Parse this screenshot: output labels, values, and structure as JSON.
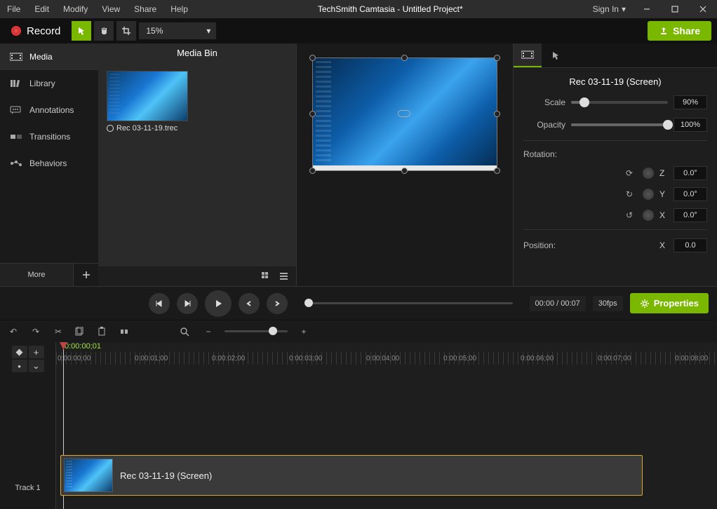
{
  "menu": [
    "File",
    "Edit",
    "Modify",
    "View",
    "Share",
    "Help"
  ],
  "title": "TechSmith Camtasia - Untitled Project*",
  "signin": "Sign In",
  "record_label": "Record",
  "zoom_value": "15%",
  "share_label": "Share",
  "sidebar": {
    "items": [
      {
        "label": "Media"
      },
      {
        "label": "Library"
      },
      {
        "label": "Annotations"
      },
      {
        "label": "Transitions"
      },
      {
        "label": "Behaviors"
      }
    ],
    "more": "More"
  },
  "bin": {
    "title": "Media Bin",
    "item_label": "Rec 03-11-19.trec"
  },
  "props": {
    "title": "Rec 03-11-19 (Screen)",
    "scale": {
      "label": "Scale",
      "value": "90%",
      "pct": 14
    },
    "opacity": {
      "label": "Opacity",
      "value": "100%",
      "pct": 100
    },
    "rotation_label": "Rotation:",
    "rot": [
      {
        "axis": "Z",
        "value": "0.0°"
      },
      {
        "axis": "Y",
        "value": "0.0°"
      },
      {
        "axis": "X",
        "value": "0.0°"
      }
    ],
    "position_label": "Position:",
    "pos": {
      "axis": "X",
      "value": "0.0"
    }
  },
  "playback": {
    "time": "00:00 / 00:07",
    "fps": "30fps",
    "properties_label": "Properties"
  },
  "timeline": {
    "playhead_time": "0:00:00;01",
    "labels": [
      "0:00:00;00",
      "0:00:01;00",
      "0:00:02;00",
      "0:00:03;00",
      "0:00:04;00",
      "0:00:05;00",
      "0:00:06;00",
      "0:00:07;00",
      "0:00:08;00"
    ],
    "track_name": "Track 1",
    "clip_label": "Rec 03-11-19 (Screen)"
  }
}
